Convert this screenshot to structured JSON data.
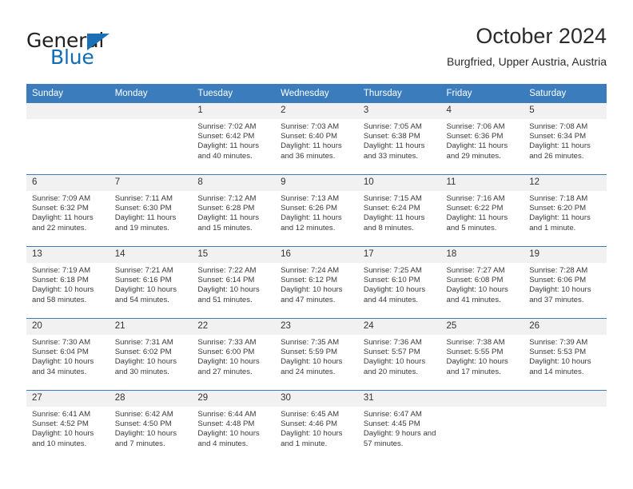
{
  "brand": {
    "name_top": "General",
    "name_bottom": "Blue",
    "accent_color": "#1a6fb5",
    "triangle_icon": "brand-triangle-icon"
  },
  "header": {
    "title": "October 2024",
    "subtitle": "Burgfried, Upper Austria, Austria"
  },
  "theme": {
    "header_blue": "#3b7cbd",
    "daynum_band": "#f1f1f1",
    "text": "#3a3a3a"
  },
  "weekday_headers": [
    "Sunday",
    "Monday",
    "Tuesday",
    "Wednesday",
    "Thursday",
    "Friday",
    "Saturday"
  ],
  "weeks": [
    [
      {
        "day": "",
        "blank": true
      },
      {
        "day": "",
        "blank": true
      },
      {
        "day": "1",
        "sunrise": "Sunrise: 7:02 AM",
        "sunset": "Sunset: 6:42 PM",
        "daylight": "Daylight: 11 hours and 40 minutes."
      },
      {
        "day": "2",
        "sunrise": "Sunrise: 7:03 AM",
        "sunset": "Sunset: 6:40 PM",
        "daylight": "Daylight: 11 hours and 36 minutes."
      },
      {
        "day": "3",
        "sunrise": "Sunrise: 7:05 AM",
        "sunset": "Sunset: 6:38 PM",
        "daylight": "Daylight: 11 hours and 33 minutes."
      },
      {
        "day": "4",
        "sunrise": "Sunrise: 7:06 AM",
        "sunset": "Sunset: 6:36 PM",
        "daylight": "Daylight: 11 hours and 29 minutes."
      },
      {
        "day": "5",
        "sunrise": "Sunrise: 7:08 AM",
        "sunset": "Sunset: 6:34 PM",
        "daylight": "Daylight: 11 hours and 26 minutes."
      }
    ],
    [
      {
        "day": "6",
        "sunrise": "Sunrise: 7:09 AM",
        "sunset": "Sunset: 6:32 PM",
        "daylight": "Daylight: 11 hours and 22 minutes."
      },
      {
        "day": "7",
        "sunrise": "Sunrise: 7:11 AM",
        "sunset": "Sunset: 6:30 PM",
        "daylight": "Daylight: 11 hours and 19 minutes."
      },
      {
        "day": "8",
        "sunrise": "Sunrise: 7:12 AM",
        "sunset": "Sunset: 6:28 PM",
        "daylight": "Daylight: 11 hours and 15 minutes."
      },
      {
        "day": "9",
        "sunrise": "Sunrise: 7:13 AM",
        "sunset": "Sunset: 6:26 PM",
        "daylight": "Daylight: 11 hours and 12 minutes."
      },
      {
        "day": "10",
        "sunrise": "Sunrise: 7:15 AM",
        "sunset": "Sunset: 6:24 PM",
        "daylight": "Daylight: 11 hours and 8 minutes."
      },
      {
        "day": "11",
        "sunrise": "Sunrise: 7:16 AM",
        "sunset": "Sunset: 6:22 PM",
        "daylight": "Daylight: 11 hours and 5 minutes."
      },
      {
        "day": "12",
        "sunrise": "Sunrise: 7:18 AM",
        "sunset": "Sunset: 6:20 PM",
        "daylight": "Daylight: 11 hours and 1 minute."
      }
    ],
    [
      {
        "day": "13",
        "sunrise": "Sunrise: 7:19 AM",
        "sunset": "Sunset: 6:18 PM",
        "daylight": "Daylight: 10 hours and 58 minutes."
      },
      {
        "day": "14",
        "sunrise": "Sunrise: 7:21 AM",
        "sunset": "Sunset: 6:16 PM",
        "daylight": "Daylight: 10 hours and 54 minutes."
      },
      {
        "day": "15",
        "sunrise": "Sunrise: 7:22 AM",
        "sunset": "Sunset: 6:14 PM",
        "daylight": "Daylight: 10 hours and 51 minutes."
      },
      {
        "day": "16",
        "sunrise": "Sunrise: 7:24 AM",
        "sunset": "Sunset: 6:12 PM",
        "daylight": "Daylight: 10 hours and 47 minutes."
      },
      {
        "day": "17",
        "sunrise": "Sunrise: 7:25 AM",
        "sunset": "Sunset: 6:10 PM",
        "daylight": "Daylight: 10 hours and 44 minutes."
      },
      {
        "day": "18",
        "sunrise": "Sunrise: 7:27 AM",
        "sunset": "Sunset: 6:08 PM",
        "daylight": "Daylight: 10 hours and 41 minutes."
      },
      {
        "day": "19",
        "sunrise": "Sunrise: 7:28 AM",
        "sunset": "Sunset: 6:06 PM",
        "daylight": "Daylight: 10 hours and 37 minutes."
      }
    ],
    [
      {
        "day": "20",
        "sunrise": "Sunrise: 7:30 AM",
        "sunset": "Sunset: 6:04 PM",
        "daylight": "Daylight: 10 hours and 34 minutes."
      },
      {
        "day": "21",
        "sunrise": "Sunrise: 7:31 AM",
        "sunset": "Sunset: 6:02 PM",
        "daylight": "Daylight: 10 hours and 30 minutes."
      },
      {
        "day": "22",
        "sunrise": "Sunrise: 7:33 AM",
        "sunset": "Sunset: 6:00 PM",
        "daylight": "Daylight: 10 hours and 27 minutes."
      },
      {
        "day": "23",
        "sunrise": "Sunrise: 7:35 AM",
        "sunset": "Sunset: 5:59 PM",
        "daylight": "Daylight: 10 hours and 24 minutes."
      },
      {
        "day": "24",
        "sunrise": "Sunrise: 7:36 AM",
        "sunset": "Sunset: 5:57 PM",
        "daylight": "Daylight: 10 hours and 20 minutes."
      },
      {
        "day": "25",
        "sunrise": "Sunrise: 7:38 AM",
        "sunset": "Sunset: 5:55 PM",
        "daylight": "Daylight: 10 hours and 17 minutes."
      },
      {
        "day": "26",
        "sunrise": "Sunrise: 7:39 AM",
        "sunset": "Sunset: 5:53 PM",
        "daylight": "Daylight: 10 hours and 14 minutes."
      }
    ],
    [
      {
        "day": "27",
        "sunrise": "Sunrise: 6:41 AM",
        "sunset": "Sunset: 4:52 PM",
        "daylight": "Daylight: 10 hours and 10 minutes."
      },
      {
        "day": "28",
        "sunrise": "Sunrise: 6:42 AM",
        "sunset": "Sunset: 4:50 PM",
        "daylight": "Daylight: 10 hours and 7 minutes."
      },
      {
        "day": "29",
        "sunrise": "Sunrise: 6:44 AM",
        "sunset": "Sunset: 4:48 PM",
        "daylight": "Daylight: 10 hours and 4 minutes."
      },
      {
        "day": "30",
        "sunrise": "Sunrise: 6:45 AM",
        "sunset": "Sunset: 4:46 PM",
        "daylight": "Daylight: 10 hours and 1 minute."
      },
      {
        "day": "31",
        "sunrise": "Sunrise: 6:47 AM",
        "sunset": "Sunset: 4:45 PM",
        "daylight": "Daylight: 9 hours and 57 minutes."
      },
      {
        "day": "",
        "blank": true
      },
      {
        "day": "",
        "blank": true
      }
    ]
  ]
}
